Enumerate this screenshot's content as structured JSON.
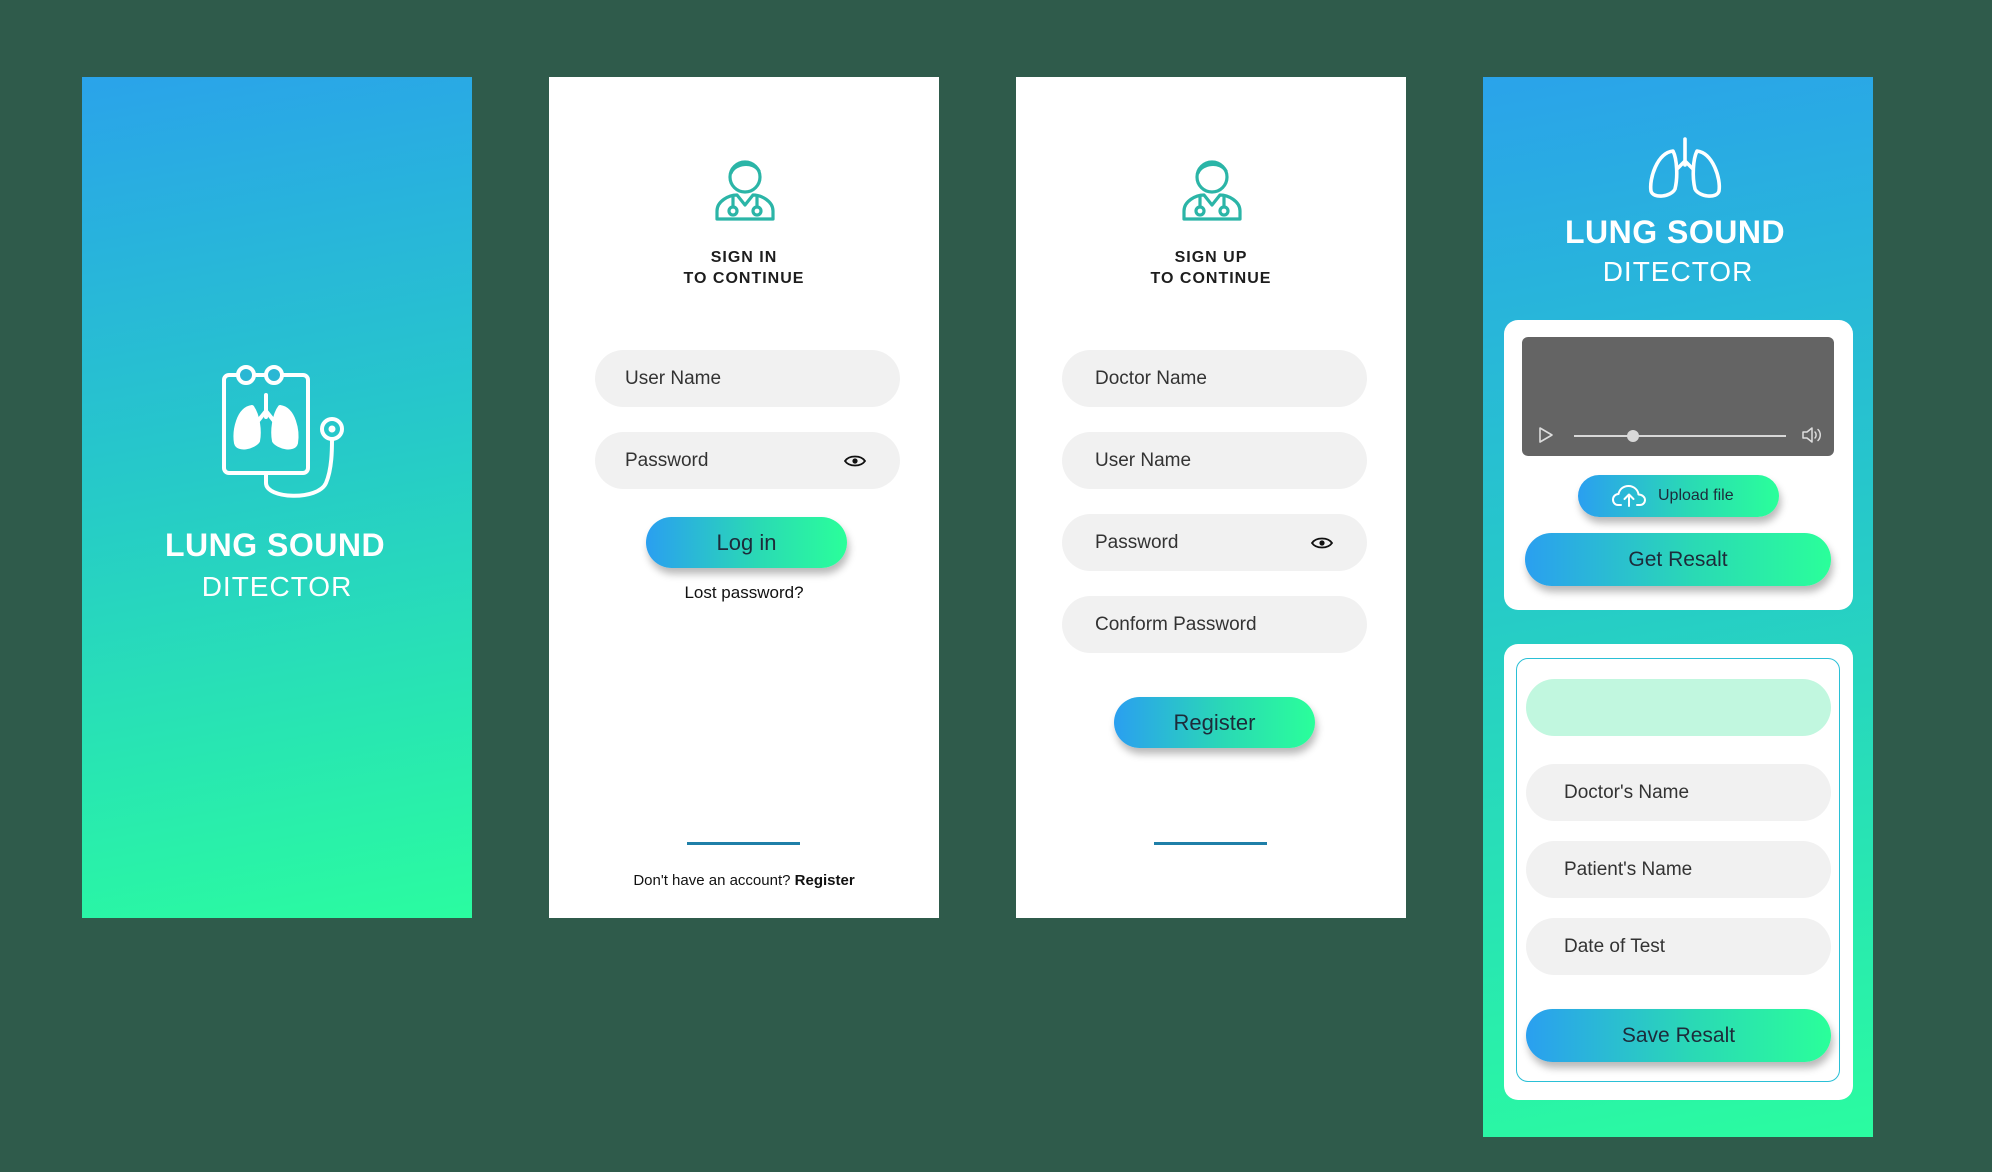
{
  "splash": {
    "title": "LUNG SOUND",
    "subtitle": "DITECTOR"
  },
  "signin": {
    "heading_line1": "SIGN IN",
    "heading_line2": "TO CONTINUE",
    "username_placeholder": "User Name",
    "password_placeholder": "Password",
    "login_label": "Log in",
    "lost_password": "Lost password?",
    "no_account_text": "Don't have an account?",
    "register_link": "Register"
  },
  "signup": {
    "heading_line1": "SIGN UP",
    "heading_line2": "TO CONTINUE",
    "doctor_name_placeholder": "Doctor Name",
    "username_placeholder": "User Name",
    "password_placeholder": "Password",
    "confirm_password_placeholder": "Conform Password",
    "register_label": "Register"
  },
  "analyze": {
    "title": "LUNG SOUND",
    "subtitle": "DITECTOR",
    "upload_label": "Upload file",
    "get_result_label": "Get Resalt",
    "doctor_name_placeholder": "Doctor's Name",
    "patient_name_placeholder": "Patient's Name",
    "date_placeholder": "Date of Test",
    "save_result_label": "Save Resalt",
    "audio_progress": 0.28
  },
  "colors": {
    "background": "#2f5b4b",
    "gradient_start": "#2aa3ea",
    "gradient_end": "#2afca0",
    "icon_teal": "#2bb5a7"
  }
}
